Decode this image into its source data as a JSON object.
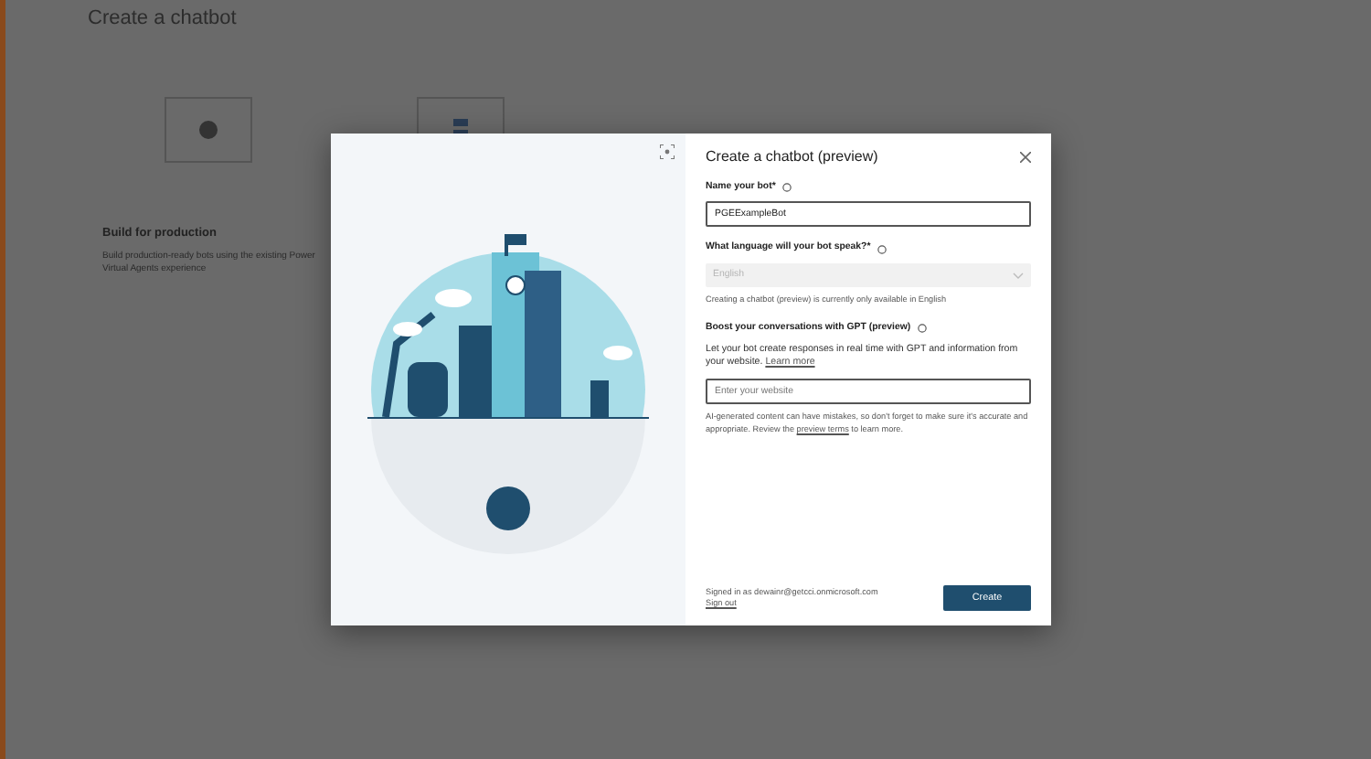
{
  "background": {
    "title": "Create a chatbot",
    "card": {
      "title": "Build for production",
      "description": "Build production-ready bots using the existing Power Virtual Agents experience"
    }
  },
  "dialog": {
    "title": "Create a chatbot (preview)",
    "name_field": {
      "label": "Name your bot*",
      "value": "PGEExampleBot"
    },
    "language_field": {
      "label": "What language will your bot speak?*",
      "value": "English",
      "disabled": true,
      "hint": "Creating a chatbot (preview) is currently only available in English"
    },
    "gpt_section": {
      "title": "Boost your conversations with GPT (preview)",
      "description": "Let your bot create responses in real time with GPT and information from your website.",
      "link": "Learn more",
      "placeholder": "Enter your website",
      "disclaimer_before": "AI-generated content can have mistakes, so don't forget to make sure it's accurate and appropriate. Review the",
      "disclaimer_link": "preview terms",
      "disclaimer_after": "to learn more."
    },
    "footer": {
      "signed_in": "Signed in as dewainr@getcci.onmicrosoft.com",
      "sign_out": "Sign out",
      "button": "Create"
    }
  }
}
